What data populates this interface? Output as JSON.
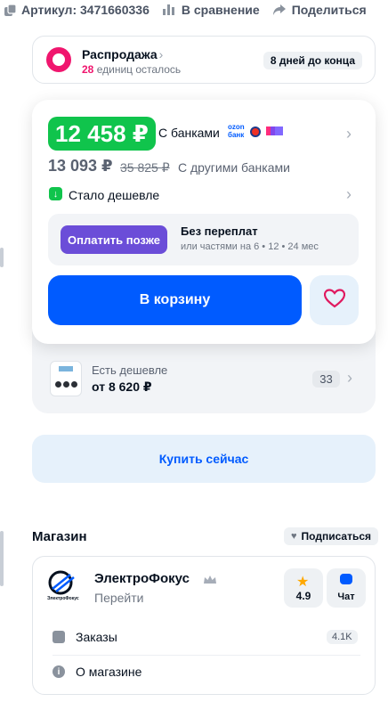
{
  "top_bar": {
    "article": "Артикул: 3471660336",
    "compare": "В сравнение",
    "share": "Поделиться"
  },
  "sale": {
    "title": "Распродажа",
    "units_count": "28",
    "units_text": "единиц осталось",
    "days_left": "8 дней до конца"
  },
  "price": {
    "main_price": "12 458 ₽",
    "with_banks": "С банками",
    "ozon_bank_logo": "ozon банк",
    "other_price": "13 093 ₽",
    "old_price": "35 825 ₽",
    "other_banks": "С другими банками",
    "cheaper": "Стало дешевле"
  },
  "pay_later": {
    "button": "Оплатить позже",
    "title": "Без переплат",
    "subtitle": "или частями на 6 • 12 • 24 мес"
  },
  "actions": {
    "add_to_cart": "В корзину",
    "buy_now": "Купить сейчас"
  },
  "cheaper_alt": {
    "label": "Есть дешевле",
    "price": "от 8 620 ₽",
    "count": "33"
  },
  "store": {
    "section_title": "Магазин",
    "subscribe": "Подписаться",
    "name": "ЭлектроФокус",
    "logo_text": "ЭлектроФокус",
    "goto": "Перейти",
    "rating": "4.9",
    "chat": "Чат",
    "orders_label": "Заказы",
    "orders_count": "4.1K",
    "about_label": "О магазине"
  },
  "colors": {
    "accent_blue": "#005bff",
    "sale_pink": "#f0166e",
    "price_green": "#10c44c",
    "pay_later_purple": "#6b4dd8",
    "rating_star": "#ffa800"
  }
}
